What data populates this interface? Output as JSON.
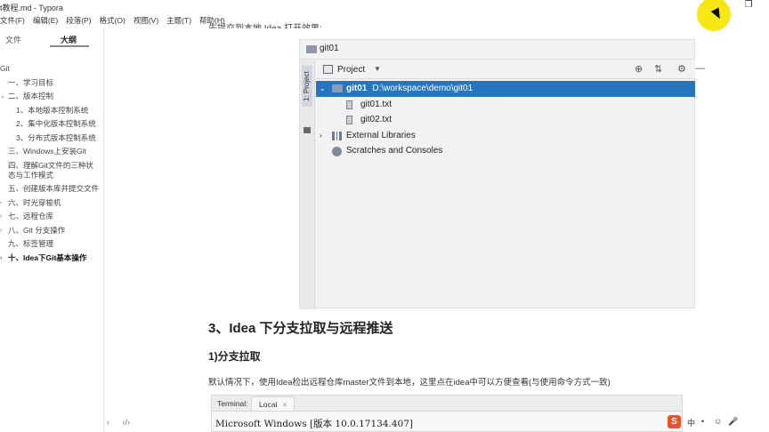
{
  "window": {
    "title": "t教程.md - Typora",
    "controls": {
      "minimize": "—",
      "restore": "❐"
    }
  },
  "menu": [
    "文件(F)",
    "编辑(E)",
    "段落(P)",
    "格式(O)",
    "视图(V)",
    "主题(T)",
    "帮助(H)"
  ],
  "sidebar": {
    "tabs": {
      "files": "文件",
      "outline": "大纲"
    },
    "outline": [
      {
        "level": 0,
        "text": "Git",
        "arrow": ""
      },
      {
        "level": 1,
        "text": "一、学习目标",
        "arrow": ""
      },
      {
        "level": 1,
        "text": "二、版本控制",
        "arrow": "⌄"
      },
      {
        "level": 2,
        "text": "1、本地版本控制系统",
        "arrow": ""
      },
      {
        "level": 2,
        "text": "2、集中化版本控制系统",
        "arrow": ""
      },
      {
        "level": 2,
        "text": "3、分布式版本控制系统",
        "arrow": ""
      },
      {
        "level": 1,
        "text": "三、Windows上安装Git",
        "arrow": ""
      },
      {
        "level": 1,
        "text": "四、理解Git文件的三种状态与工作模式",
        "arrow": ""
      },
      {
        "level": 1,
        "text": "五、创建版本库并提交文件",
        "arrow": ""
      },
      {
        "level": 1,
        "text": "六、时光穿梭机",
        "arrow": "›"
      },
      {
        "level": 1,
        "text": "七、远程仓库",
        "arrow": "›"
      },
      {
        "level": 1,
        "text": "八、Git 分支操作",
        "arrow": "›"
      },
      {
        "level": 1,
        "text": "九、标签管理",
        "arrow": ""
      },
      {
        "level": 1,
        "text": "十、Idea下Git基本操作",
        "arrow": "›",
        "active": true
      }
    ],
    "footer": {
      "back": "‹",
      "source": "‹/›"
    }
  },
  "content": {
    "top_cut_text": "先提交到本地 Idea 打开效果:",
    "ide": {
      "window_title": "git01",
      "side_label": "1: Project",
      "toolbar": {
        "label": "Project",
        "dropdown": "▼",
        "icons": [
          "⊕",
          "⇅",
          "⚙",
          "—"
        ]
      },
      "tree": [
        {
          "kind": "project",
          "name": "git01",
          "path": "D:\\workspace\\demo\\git01",
          "selected": true,
          "chevron": "⌄"
        },
        {
          "kind": "file",
          "name": "git01.txt"
        },
        {
          "kind": "file",
          "name": "git02.txt"
        },
        {
          "kind": "lib",
          "name": "External Libraries",
          "chevron": "›"
        },
        {
          "kind": "scratch",
          "name": "Scratches and Consoles"
        }
      ]
    },
    "h2": "3、Idea 下分支拉取与远程推送",
    "h3": "1)分支拉取",
    "paragraph": "默认情况下，使用Idea检出远程仓库master文件到本地，这里点在idea中可以方便查看(与使用命令方式一致)",
    "terminal": {
      "tab_label": "Terminal:",
      "active_tab": "Local",
      "close": "×",
      "line": "Microsoft Windows [版本 10.0.17134.407]"
    }
  },
  "ime": {
    "logo": "S",
    "items": [
      "中",
      "•",
      "☺",
      "🎤"
    ]
  }
}
